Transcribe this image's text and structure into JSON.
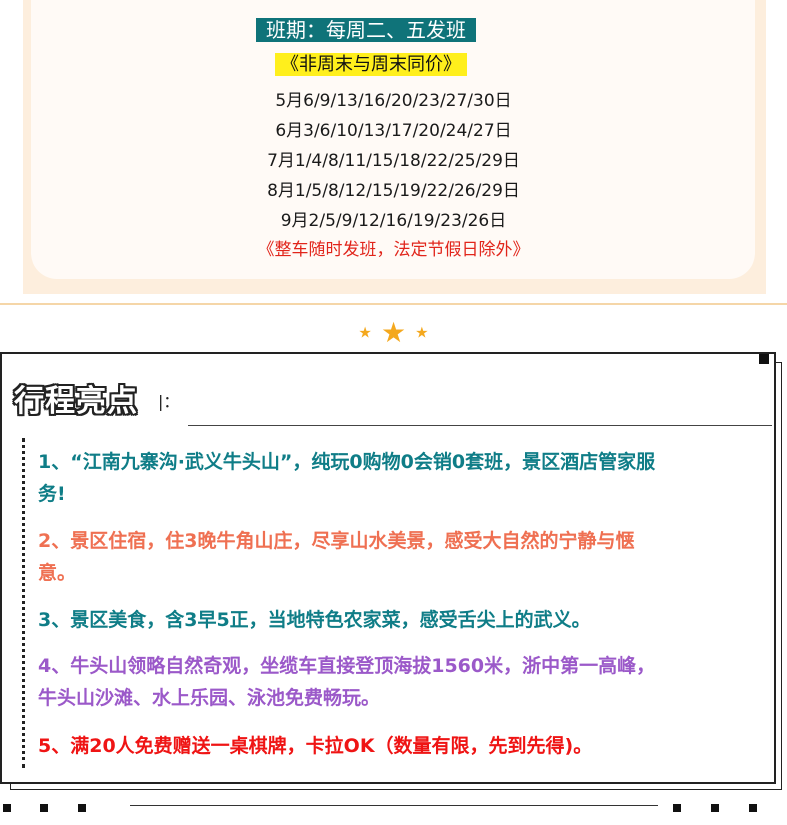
{
  "schedule": {
    "title": "班期：每周二、五发班",
    "subtitle": "《非周末与周末同价》",
    "dates": [
      "5月6/9/13/16/20/23/27/30日",
      "6月3/6/10/13/17/20/24/27日",
      "7月1/4/8/11/15/18/22/25/29日",
      "8月1/5/8/12/15/19/22/26/29日",
      "9月2/5/9/12/16/19/23/26日"
    ],
    "note": "《整车随时发班，法定节假日除外》"
  },
  "divider": {
    "stars": [
      "★",
      "★",
      "★"
    ],
    "star_color": "#f4a81e"
  },
  "highlights": {
    "title": "行程亮点",
    "colon": "|：",
    "items": [
      {
        "line1": "1、“江南九寨沟·武义牛头山”，纯玩0购物0会销0套班，景区酒店管家服",
        "line2": "务!",
        "color": "#0f7d87"
      },
      {
        "line1": "2、景区住宿，住3晚牛角山庄，尽享山水美景，感受大自然的宁静与惬",
        "line2": "意。",
        "color": "#ef7052"
      },
      {
        "line1": "3、景区美食，含3早5正，当地特色农家菜，感受舌尖上的武义。",
        "line2": "",
        "color": "#0f7d87"
      },
      {
        "line1": "4、牛头山领略自然奇观，坐缆车直接登顶海拔1560米，浙中第一高峰，",
        "line2": "牛头山沙滩、水上乐园、泳池免费畅玩。",
        "color": "#9b59c9"
      },
      {
        "line1": "5、满20人免费赠送一桌棋牌，卡拉OK（数量有限，先到先得)。",
        "line2": "",
        "color": "#ef1414"
      }
    ]
  },
  "colors": {
    "title_badge": "#0f7379",
    "subtitle_badge": "#ffef1c",
    "note": "#e1251b",
    "card_frame": "#fdeedd"
  }
}
